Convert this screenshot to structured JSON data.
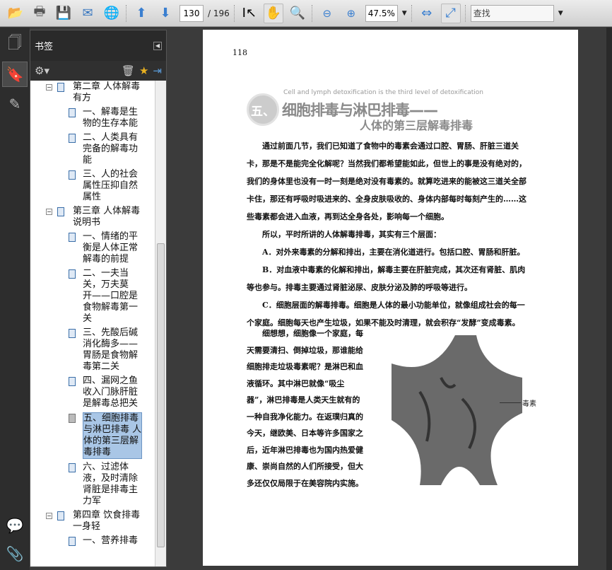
{
  "toolbar": {
    "page_current": "130",
    "page_total": "/ 196",
    "zoom": "47.5%",
    "find_placeholder": "查找"
  },
  "panel": {
    "title": "书签"
  },
  "bookmarks": [
    {
      "level": 0,
      "label": "第二章 人体解毒\n有方",
      "toggle": "−"
    },
    {
      "level": 1,
      "label": "一、解毒是生\n物的生存本能"
    },
    {
      "level": 1,
      "label": "二、人类具有\n完备的解毒功\n能"
    },
    {
      "level": 1,
      "label": "三、人的社会\n属性压抑自然\n属性"
    },
    {
      "level": 0,
      "label": "第三章 人体解毒\n说明书",
      "toggle": "−"
    },
    {
      "level": 1,
      "label": "一、情绪的平\n衡是人体正常\n解毒的前提"
    },
    {
      "level": 1,
      "label": "二、一夫当\n关，万夫莫\n开——口腔是\n食物解毒第一\n关"
    },
    {
      "level": 1,
      "label": "三、先酸后碱\n消化酶多——\n胃肠是食物解\n毒第二关"
    },
    {
      "level": 1,
      "label": "四、漏网之鱼\n收入门脉肝脏\n是解毒总把关"
    },
    {
      "level": 1,
      "label": "五、细胞排毒\n与淋巴排毒 人\n体的第三层解\n毒排毒",
      "selected": true
    },
    {
      "level": 1,
      "label": "六、过滤体\n液，及时清除\n肾脏是排毒主\n力军"
    },
    {
      "level": 0,
      "label": "第四章 饮食排毒\n一身轻",
      "toggle": "−"
    },
    {
      "level": 1,
      "label": "一、营养排毒"
    }
  ],
  "document": {
    "page_number": "118",
    "subtitle_en": "Cell and lymph detoxification is the third level of detoxification",
    "badge": "五、",
    "title_line1": "细胞排毒与淋巴排毒——",
    "title_line2": "人体的第三层解毒排毒",
    "para_lines": [
      "　　通过前面几节，我们已知道了食物中的毒素会通过口腔、胃肠、肝脏三道关",
      "卡，那是不是能完全化解呢？当然我们都希望能如此，但世上的事是没有绝对的，",
      "我们的身体里也没有一时一刻是绝对没有毒素的。就算吃进来的能被这三道关全部",
      "卡住，那还有呼吸时吸进来的、全身皮肤吸收的、身体内部每时每刻产生的……这",
      "些毒素都会进入血液，再到达全身各处，影响每一个细胞。",
      "　　所以，平时所讲的人体解毒排毒，其实有三个层面：",
      "　　A．对外来毒素的分解和排出，主要在消化道进行。包括口腔、胃肠和肝脏。",
      "　　B．对血液中毒素的化解和排出，解毒主要在肝脏完成，其次还有肾脏、肌肉",
      "等也参与。排毒主要通过肾脏泌尿、皮肤分泌及肺的呼吸等进行。",
      "　　C．细胞层面的解毒排毒。细胞是人体的最小功能单位，就像组成社会的每一",
      "个家庭。细胞每天也产生垃圾，如果不能及时清理，就会积存“发酵”变成毒素。"
    ],
    "side_lines": [
      "　　细想想，细胞像一个家庭，每",
      "天需要清扫、倒掉垃圾，那谁能给",
      "细胞排走垃圾毒素呢？是淋巴和血",
      "液循环。其中淋巴就像“吸尘",
      "器”，淋巴排毒是人类天生就有的",
      "一种自我净化能力。在返璞归真的",
      "今天，继欧美、日本等许多国家之",
      "后，近年淋巴排毒也为国内热爱健",
      "康、崇尚自然的人们所接受，但大",
      "多还仅仅局限于在美容院内实施。"
    ],
    "figure_label": "毒素"
  }
}
